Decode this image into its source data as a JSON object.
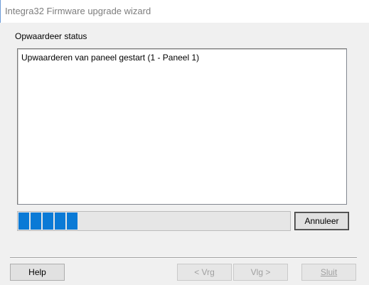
{
  "window": {
    "title": "Integra32 Firmware upgrade wizard"
  },
  "status": {
    "label": "Opwaardeer status",
    "log_lines": [
      "Upwaarderen van paneel gestart (1 - Paneel 1)"
    ]
  },
  "progress": {
    "fraction": 0.22,
    "color": "#0a7ad6"
  },
  "buttons": {
    "cancel_label": "Annuleer",
    "help_label": "Help",
    "back_label": "< Vrg",
    "next_label": "Vlg >",
    "close_label": "Sluit"
  }
}
